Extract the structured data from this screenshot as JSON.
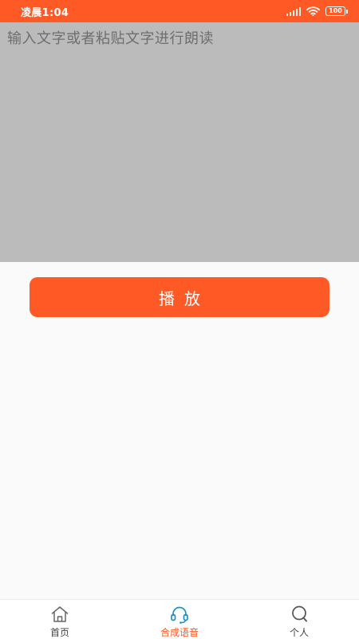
{
  "status_bar": {
    "time": "凌晨1:04",
    "battery": "100",
    "icons": [
      "signal-icon",
      "wifi-icon",
      "battery-icon"
    ]
  },
  "editor": {
    "placeholder": "输入文字或者粘贴文字进行朗读",
    "value": ""
  },
  "play_button": {
    "label": "播放"
  },
  "tab_bar": {
    "items": [
      {
        "label": "首页",
        "icon": "home-icon",
        "active": false
      },
      {
        "label": "合成语音",
        "icon": "headset-icon",
        "active": true
      },
      {
        "label": "个人",
        "icon": "person-icon",
        "active": false
      }
    ]
  },
  "colors": {
    "accent": "#ff5a26",
    "editor_background": "#bbbbbb",
    "page_background": "#fafafa",
    "active_icon": "#1f8fc4"
  }
}
